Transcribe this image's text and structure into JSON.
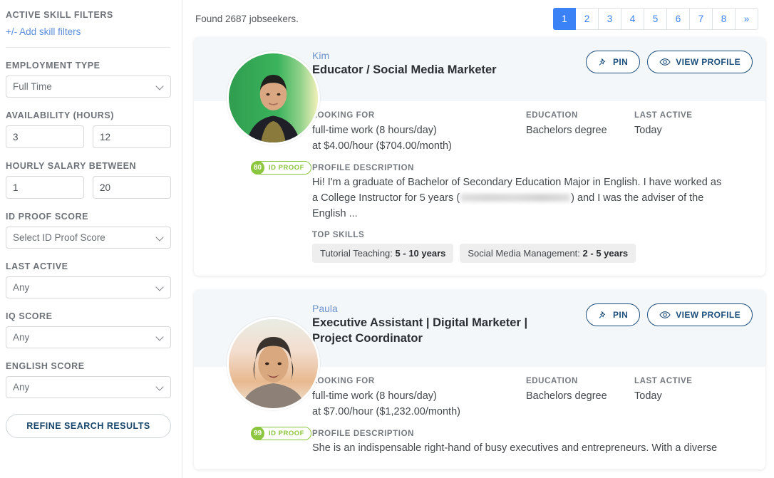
{
  "sidebar": {
    "active_skill_filters_label": "ACTIVE SKILL FILTERS",
    "add_skill_filters_link": "+/- Add skill filters",
    "employment_type_label": "EMPLOYMENT TYPE",
    "employment_type_value": "Full Time",
    "availability_label": "AVAILABILITY (HOURS)",
    "availability_min": "3",
    "availability_max": "12",
    "hourly_salary_label": "HOURLY SALARY BETWEEN",
    "hourly_salary_min": "1",
    "hourly_salary_max": "20",
    "id_proof_score_label": "ID PROOF SCORE",
    "id_proof_score_value": "Select ID Proof Score",
    "last_active_label": "LAST ACTIVE",
    "last_active_value": "Any",
    "iq_score_label": "IQ SCORE",
    "iq_score_value": "Any",
    "english_score_label": "ENGLISH SCORE",
    "english_score_value": "Any",
    "refine_button": "REFINE SEARCH RESULTS"
  },
  "header": {
    "found_text": "Found 2687 jobseekers.",
    "pagination": [
      "1",
      "2",
      "3",
      "4",
      "5",
      "6",
      "7",
      "8",
      "»"
    ],
    "active_page": "1"
  },
  "labels": {
    "looking_for": "LOOKING FOR",
    "education": "EDUCATION",
    "last_active": "LAST ACTIVE",
    "profile_description": "PROFILE DESCRIPTION",
    "top_skills": "TOP SKILLS",
    "pin": "PIN",
    "view_profile": "VIEW PROFILE",
    "id_proof": "ID PROOF"
  },
  "colors": {
    "accent_blue": "#3b82f6",
    "button_navy": "#1d4f7c",
    "badge_green": "#8cc63f",
    "card_header_bg": "#f4f7f9",
    "name_link": "#6d94cc"
  },
  "cards": [
    {
      "name": "Kim",
      "title": "Educator / Social Media Marketer",
      "id_proof_score": "80",
      "looking_for_line1": "full-time work (8 hours/day)",
      "looking_for_line2": "at $4.00/hour ($704.00/month)",
      "education": "Bachelors degree",
      "last_active": "Today",
      "description_part1": "Hi! I'm a graduate of Bachelor of Secondary Education Major in English. I have worked as a College Instructor for 5 years (",
      "description_part2": ") and I was the adviser of the English ...",
      "skills": [
        {
          "name": "Tutorial Teaching:",
          "years": "5 - 10 years"
        },
        {
          "name": "Social Media Management:",
          "years": "2 - 5 years"
        }
      ]
    },
    {
      "name": "Paula",
      "title": "Executive Assistant | Digital Marketer | Project Coordinator",
      "id_proof_score": "99",
      "looking_for_line1": "full-time work (8 hours/day)",
      "looking_for_line2": "at $7.00/hour ($1,232.00/month)",
      "education": "Bachelors degree",
      "last_active": "Today",
      "description_part1": "She is an indispensable right-hand of busy executives and entrepreneurs. With a diverse",
      "description_part2": "",
      "skills": []
    }
  ]
}
